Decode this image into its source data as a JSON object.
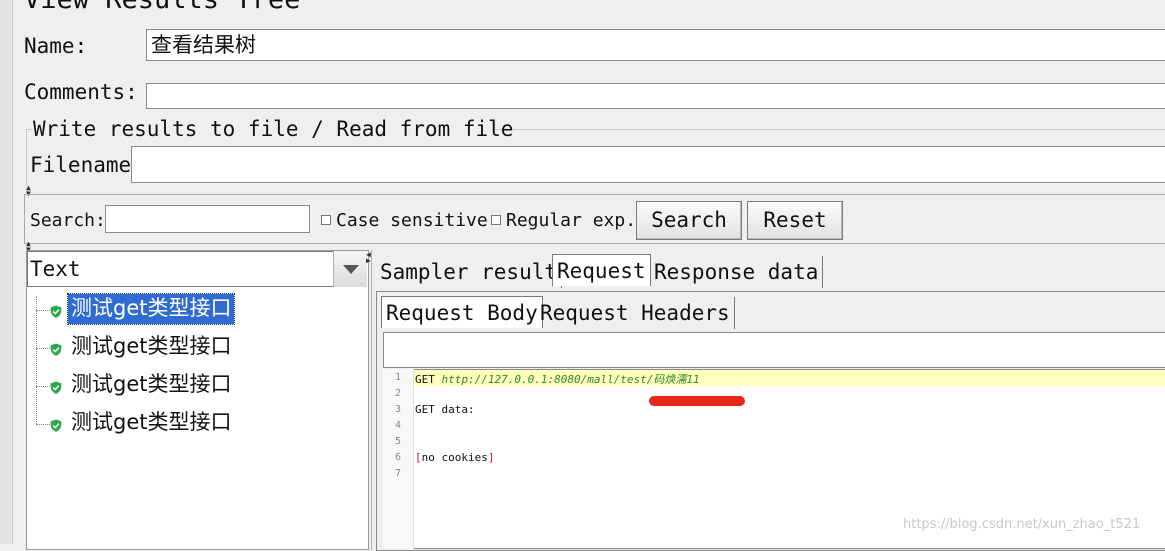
{
  "window": {
    "title": "View Results Tree"
  },
  "form": {
    "name_label": "Name:",
    "name_value": "查看结果树",
    "comments_label": "Comments:",
    "comments_value": "",
    "fileset_legend": "Write results to file / Read from file",
    "filename_label": "Filename",
    "filename_value": ""
  },
  "search": {
    "label": "Search:",
    "value": "",
    "case_sensitive_label": "Case sensitive",
    "case_sensitive_checked": false,
    "regex_label": "Regular exp.",
    "regex_checked": false,
    "search_button": "Search",
    "reset_button": "Reset"
  },
  "renderer": {
    "selected": "Text"
  },
  "tree": {
    "items": [
      {
        "label": "测试get类型接口",
        "status": "success",
        "selected": true
      },
      {
        "label": "测试get类型接口",
        "status": "success",
        "selected": false
      },
      {
        "label": "测试get类型接口",
        "status": "success",
        "selected": false
      },
      {
        "label": "测试get类型接口",
        "status": "success",
        "selected": false
      }
    ]
  },
  "tabs": {
    "main": [
      "Sampler result",
      "Request",
      "Response data"
    ],
    "main_active": "Request",
    "sub": [
      "Request Body",
      "Request Headers"
    ],
    "sub_active": "Request Body"
  },
  "editor": {
    "line_numbers": [
      "1",
      "2",
      "3",
      "4",
      "5",
      "6",
      "7"
    ],
    "lines": [
      {
        "method": "GET",
        "url": "http://127.0.0.1:8080/mall/test/码焕濡11"
      },
      {
        "text": ""
      },
      {
        "text": "GET data:"
      },
      {
        "text": ""
      },
      {
        "text": ""
      },
      {
        "bracket_open": "[",
        "text": "no cookies",
        "bracket_close": "]"
      },
      {
        "text": ""
      }
    ]
  },
  "watermark": "https://blog.csdn.net/xun_zhao_t521",
  "colors": {
    "selection": "#2f6bd1",
    "success_icon": "#2aa84a",
    "url": "#2b8a2b",
    "bracket": "#d11b1b",
    "highlight_line": "#ffffbe",
    "annotation_mark": "#e8261a"
  }
}
